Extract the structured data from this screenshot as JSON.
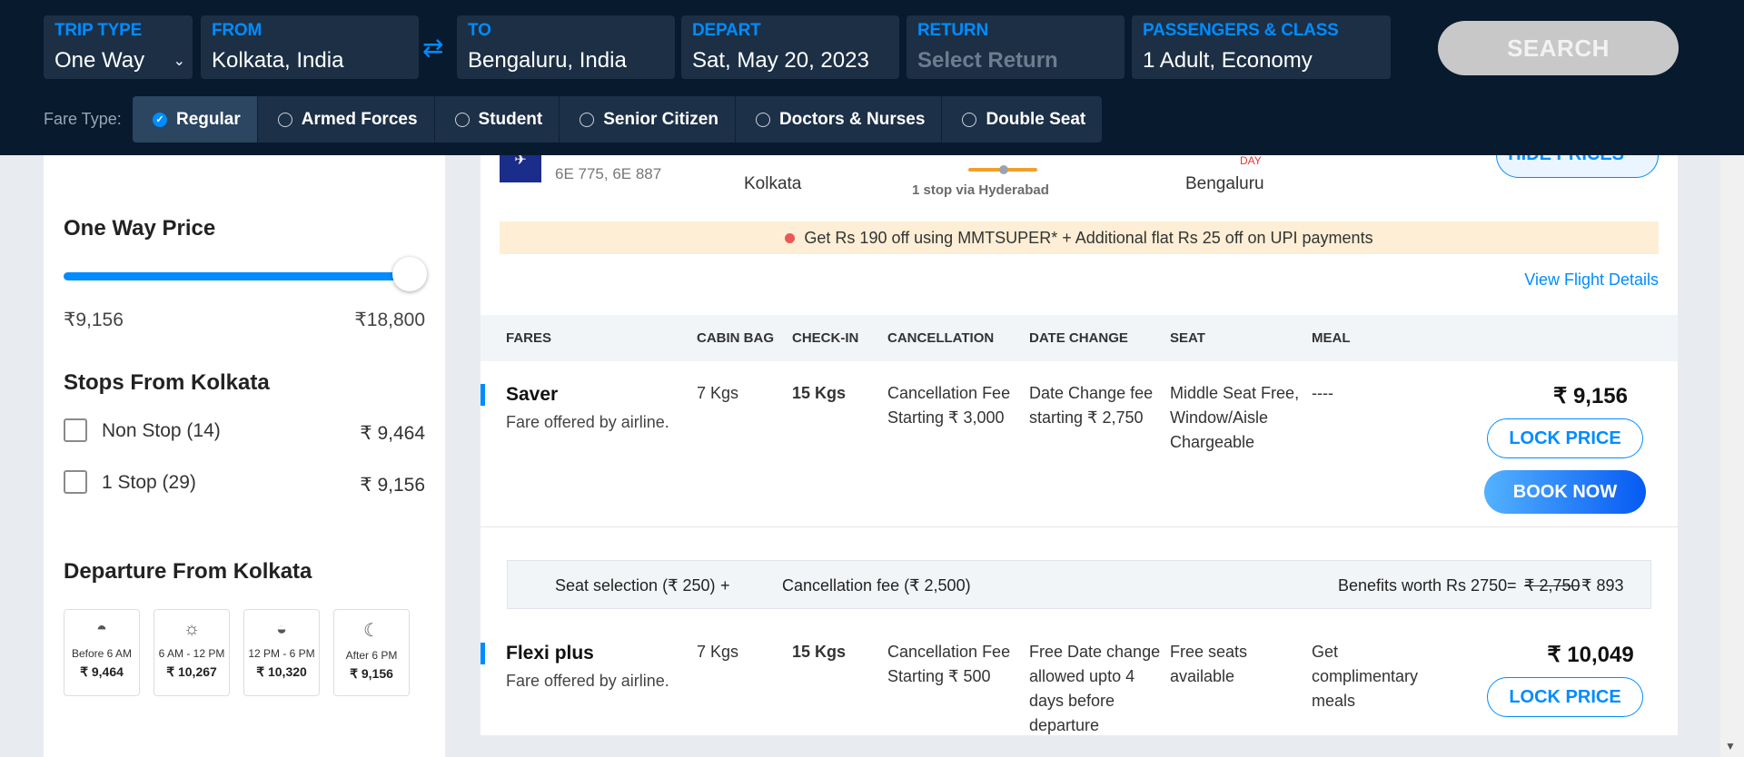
{
  "search": {
    "trip_type": {
      "label": "TRIP TYPE",
      "value": "One Way"
    },
    "from": {
      "label": "FROM",
      "value": "Kolkata, India"
    },
    "to": {
      "label": "TO",
      "value": "Bengaluru, India"
    },
    "depart": {
      "label": "DEPART",
      "value": "Sat, May 20, 2023"
    },
    "return": {
      "label": "RETURN",
      "value": "Select Return"
    },
    "passengers": {
      "label": "PASSENGERS & CLASS",
      "value": "1 Adult, Economy"
    },
    "search_button": "SEARCH",
    "swap_icon": "⇄"
  },
  "fare_type": {
    "label": "Fare Type:",
    "options": [
      "Regular",
      "Armed Forces",
      "Student",
      "Senior Citizen",
      "Doctors & Nurses",
      "Double Seat"
    ],
    "selected": "Regular"
  },
  "filters": {
    "price_title": "One Way Price",
    "price_min": "₹9,156",
    "price_max": "₹18,800",
    "price_slider_fraction": 1.0,
    "stops_title": "Stops From Kolkata",
    "stops": [
      {
        "label": "Non Stop (14)",
        "price": "₹ 9,464"
      },
      {
        "label": "1 Stop (29)",
        "price": "₹ 9,156"
      }
    ],
    "departure_title": "Departure From Kolkata",
    "slots": [
      {
        "icon": "sunrise-icon",
        "label": "Before 6 AM",
        "price": "₹ 9,464"
      },
      {
        "icon": "sun-icon",
        "label": "6 AM - 12 PM",
        "price": "₹ 10,267"
      },
      {
        "icon": "sunset-icon",
        "label": "12 PM - 6 PM",
        "price": "₹ 10,320"
      },
      {
        "icon": "moon-icon",
        "label": "After 6 PM",
        "price": "₹ 9,156"
      }
    ]
  },
  "flight": {
    "numbers": "6E 775, 6E 887",
    "from_city": "Kolkata",
    "stop_info": "1 stop via Hyderabad",
    "to_city": "Bengaluru",
    "day_tag": "DAY",
    "hide_prices": "HIDE PRICES",
    "promo": "Get Rs 190 off using MMTSUPER* + Additional flat Rs 25 off on UPI payments",
    "view_details": "View Flight Details"
  },
  "fare_table": {
    "headers": [
      "FARES",
      "CABIN BAG",
      "CHECK-IN",
      "CANCELLATION",
      "DATE CHANGE",
      "SEAT",
      "MEAL"
    ],
    "rows": [
      {
        "name": "Saver",
        "sub": "Fare offered by airline.",
        "cabin": "7 Kgs",
        "checkin": "15 Kgs",
        "cancellation": "Cancellation Fee Starting ₹ 3,000",
        "date_change": "Date Change fee starting ₹ 2,750",
        "seat": "Middle Seat Free, Window/Aisle Chargeable",
        "meal": "----",
        "price": "₹ 9,156",
        "lock": "LOCK PRICE",
        "book": "BOOK NOW"
      },
      {
        "name": "Flexi plus",
        "sub": "Fare offered by airline.",
        "cabin": "7 Kgs",
        "checkin": "15 Kgs",
        "cancellation": "Cancellation Fee Starting ₹ 500",
        "date_change": "Free Date change allowed upto 4 days before departure",
        "seat": "Free seats available",
        "meal": "Get complimentary meals",
        "price": "₹ 10,049",
        "lock": "LOCK PRICE"
      }
    ],
    "benefits": {
      "seat": "Seat selection (₹ 250)",
      "plus": "+",
      "cancel": "Cancellation fee (₹ 2,500)",
      "worth": "Benefits worth Rs 2750",
      "equals": "=",
      "old_price": "₹ 2,750",
      "new_price": "₹ 893"
    }
  },
  "colors": {
    "header_bg": "#071a2e",
    "accent": "#008cff",
    "promo_bg": "#fdeed5"
  }
}
